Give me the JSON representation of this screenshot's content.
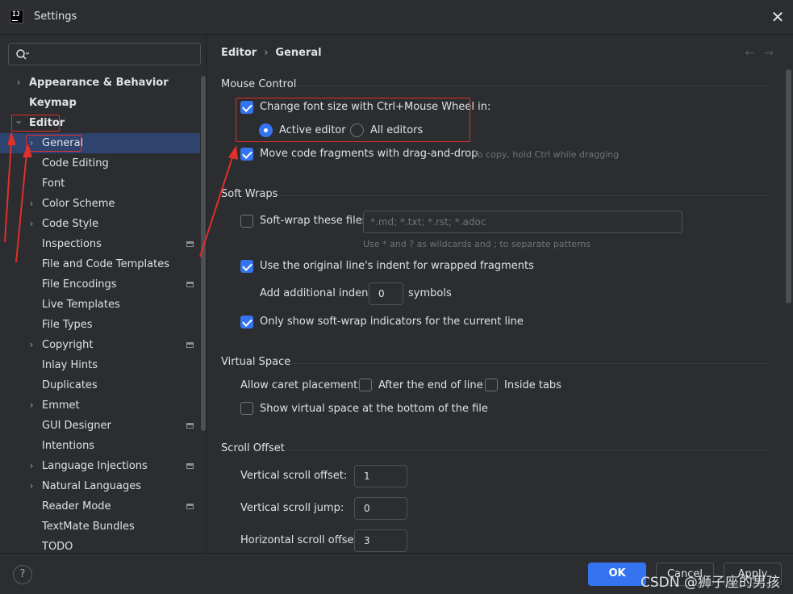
{
  "window": {
    "title": "Settings",
    "app_icon_text": "IJ"
  },
  "search": {
    "placeholder": ""
  },
  "breadcrumb": {
    "parent": "Editor",
    "current": "General"
  },
  "sidebar": {
    "items": [
      {
        "label": "Appearance & Behavior",
        "bold": true,
        "chevron": "right",
        "indent": 0
      },
      {
        "label": "Keymap",
        "bold": true,
        "chevron": "",
        "indent": 0
      },
      {
        "label": "Editor",
        "bold": true,
        "chevron": "down",
        "indent": 0
      },
      {
        "label": "General",
        "bold": false,
        "chevron": "right",
        "indent": 1,
        "selected": true
      },
      {
        "label": "Code Editing",
        "indent": 1,
        "chevron": ""
      },
      {
        "label": "Font",
        "indent": 1,
        "chevron": ""
      },
      {
        "label": "Color Scheme",
        "indent": 1,
        "chevron": "right"
      },
      {
        "label": "Code Style",
        "indent": 1,
        "chevron": "right"
      },
      {
        "label": "Inspections",
        "indent": 1,
        "chevron": "",
        "project": true
      },
      {
        "label": "File and Code Templates",
        "indent": 1,
        "chevron": ""
      },
      {
        "label": "File Encodings",
        "indent": 1,
        "chevron": "",
        "project": true
      },
      {
        "label": "Live Templates",
        "indent": 1,
        "chevron": ""
      },
      {
        "label": "File Types",
        "indent": 1,
        "chevron": ""
      },
      {
        "label": "Copyright",
        "indent": 1,
        "chevron": "right",
        "project": true
      },
      {
        "label": "Inlay Hints",
        "indent": 1,
        "chevron": ""
      },
      {
        "label": "Duplicates",
        "indent": 1,
        "chevron": ""
      },
      {
        "label": "Emmet",
        "indent": 1,
        "chevron": "right"
      },
      {
        "label": "GUI Designer",
        "indent": 1,
        "chevron": "",
        "project": true
      },
      {
        "label": "Intentions",
        "indent": 1,
        "chevron": ""
      },
      {
        "label": "Language Injections",
        "indent": 1,
        "chevron": "right",
        "project": true
      },
      {
        "label": "Natural Languages",
        "indent": 1,
        "chevron": "right"
      },
      {
        "label": "Reader Mode",
        "indent": 1,
        "chevron": "",
        "project": true
      },
      {
        "label": "TextMate Bundles",
        "indent": 1,
        "chevron": ""
      },
      {
        "label": "TODO",
        "indent": 1,
        "chevron": ""
      }
    ]
  },
  "mouse_control": {
    "title": "Mouse Control",
    "change_font_size": {
      "label": "Change font size with Ctrl+Mouse Wheel in:",
      "checked": true
    },
    "active_editor": {
      "label": "Active editor",
      "selected": true
    },
    "all_editors": {
      "label": "All editors",
      "selected": false
    },
    "drag_drop": {
      "label": "Move code fragments with drag-and-drop",
      "checked": true,
      "hint": "To copy, hold Ctrl while dragging"
    }
  },
  "soft_wraps": {
    "title": "Soft Wraps",
    "soft_wrap_files": {
      "label": "Soft-wrap these files:",
      "checked": false,
      "placeholder": "*.md; *.txt; *.rst; *.adoc",
      "hint": "Use * and ? as wildcards and ; to separate patterns"
    },
    "original_indent": {
      "label": "Use the original line's indent for wrapped fragments",
      "checked": true
    },
    "additional_indent": {
      "label": "Add additional indent:",
      "value": "0",
      "unit": "symbols"
    },
    "current_line": {
      "label": "Only show soft-wrap indicators for the current line",
      "checked": true
    }
  },
  "virtual_space": {
    "title": "Virtual Space",
    "caret_label": "Allow caret placement:",
    "after_end": {
      "label": "After the end of line",
      "checked": false
    },
    "inside_tabs": {
      "label": "Inside tabs",
      "checked": false
    },
    "show_bottom": {
      "label": "Show virtual space at the bottom of the file",
      "checked": false
    }
  },
  "scroll_offset": {
    "title": "Scroll Offset",
    "vertical_offset": {
      "label": "Vertical scroll offset:",
      "value": "1"
    },
    "vertical_jump": {
      "label": "Vertical scroll jump:",
      "value": "0"
    },
    "horizontal_offset": {
      "label": "Horizontal scroll offset:",
      "value": "3"
    }
  },
  "footer": {
    "help": "?",
    "ok": "OK",
    "cancel": "Cancel",
    "apply": "Apply"
  },
  "watermark": "CSDN @狮子座的男孩",
  "colors": {
    "accent": "#3574f0",
    "annotation": "#e0302a",
    "selection": "#2e436e",
    "background": "#2b2d30"
  }
}
